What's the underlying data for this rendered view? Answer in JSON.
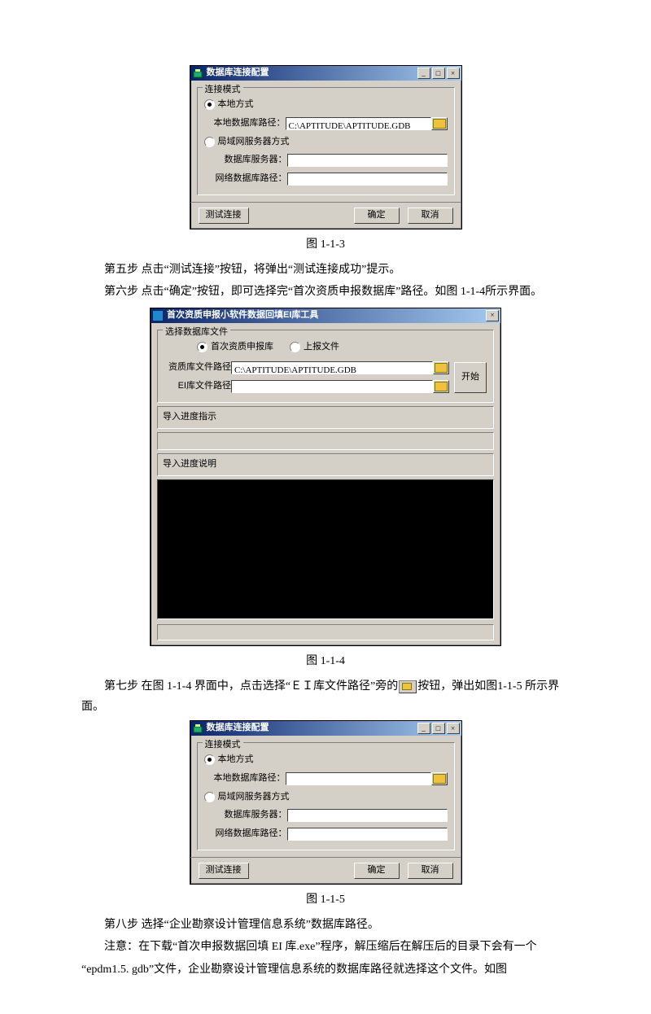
{
  "dlg1": {
    "title": "数据库连接配置",
    "group": "连接模式",
    "opt_local": "本地方式",
    "lab_localpath": "本地数据库路径：",
    "val_localpath": "C:\\APTITUDE\\APTITUDE.GDB",
    "opt_lan": "局域网服务器方式",
    "lab_server": "数据库服务器：",
    "lab_netpath": "网络数据库路径：",
    "btn_test": "测试连接",
    "btn_ok": "确定",
    "btn_cancel": "取消"
  },
  "cap1": "图 1-1-3",
  "p5": "第五步    点击“测试连接”按钮，将弹出“测试连接成功”提示。",
  "p6": "第六步    点击“确定”按钮，即可选择完“首次资质申报数据库”路径。如图 1-1-4所示界面。",
  "dlg2": {
    "title": "首次资质申报小软件数据回填EI库工具",
    "group": "选择数据库文件",
    "opt_first": "首次资质申报库",
    "opt_upload": "上报文件",
    "lab_qpath": "资质库文件路径",
    "val_qpath": "C:\\APTITUDE\\APTITUDE.GDB",
    "lab_eipath": "EI库文件路径",
    "btn_start": "开始",
    "lab_prog": "导入进度指示",
    "lab_desc": "导入进度说明"
  },
  "cap2": "图 1-1-4",
  "p7a": "第七步     在图 1-1-4 界面中，点击选择“ＥＩ库文件路径”旁的",
  "p7b": "按钮，弹出如图1-1-5 所示界面。",
  "dlg3": {
    "title": "数据库连接配置",
    "group": "连接模式",
    "opt_local": "本地方式",
    "lab_localpath": "本地数据库路径：",
    "opt_lan": "局域网服务器方式",
    "lab_server": "数据库服务器：",
    "lab_netpath": "网络数据库路径：",
    "btn_test": "测试连接",
    "btn_ok": "确定",
    "btn_cancel": "取消"
  },
  "cap3": "图 1-1-5",
  "p8": "第八步    选择“企业勘察设计管理信息系统”数据库路径。",
  "note1": "注意：在下载“首次申报数据回填 EI 库.exe”程序，解压缩后在解压后的目录下会有一个",
  "note2": "“epdm1.5. gdb”文件，企业勘察设计管理信息系统的数据库路径就选择这个文件。如图"
}
